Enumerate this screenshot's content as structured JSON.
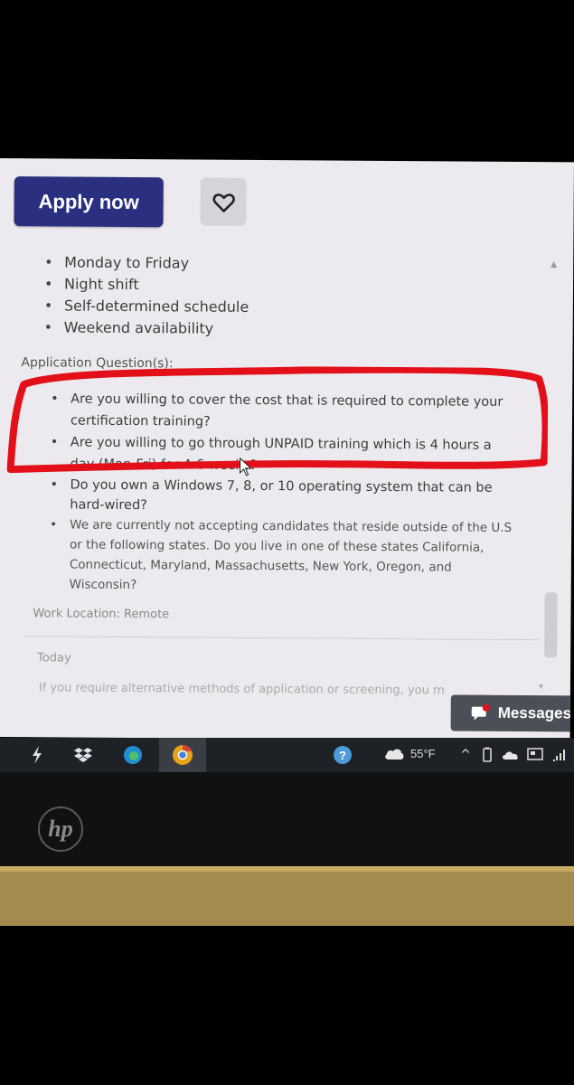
{
  "job": {
    "apply_label": "Apply now",
    "save_icon": "heart-icon",
    "schedule": [
      "Monday to Friday",
      "Night shift",
      "Self-determined schedule",
      "Weekend availability"
    ],
    "application_questions_label": "Application Question(s):",
    "questions": [
      "Are you willing to cover the cost that is required to complete your certification training?",
      "Are you willing to go through UNPAID training which is 4 hours a day (Mon-Fri) for 4-6 weeks?",
      "Do you own a Windows 7, 8, or 10 operating system that can be hard-wired?",
      "We are currently not accepting candidates that reside outside of the U.S or the following states. Do you live in one of these states California, Connecticut, Maryland, Massachusetts, New York, Oregon, and Wisconsin?"
    ],
    "work_location": "Work Location: Remote",
    "posted": "Today",
    "footer_text": "If you require alternative methods of application or screening, you must"
  },
  "messages": {
    "label": "Messages",
    "icon": "chat-icon"
  },
  "taskbar": {
    "weather_temp": "55°F",
    "icons": [
      "app-icon",
      "dropbox-icon",
      "edge-icon",
      "chrome-icon",
      "help-icon",
      "weather-icon",
      "chevron-up-icon",
      "battery-icon",
      "onedrive-icon",
      "display-icon",
      "wifi-icon"
    ]
  },
  "laptop": {
    "brand": "hp"
  },
  "colors": {
    "apply_bg": "#2a2f7f",
    "annotation_red": "#e3101a",
    "taskbar_bg": "#1e2126"
  }
}
